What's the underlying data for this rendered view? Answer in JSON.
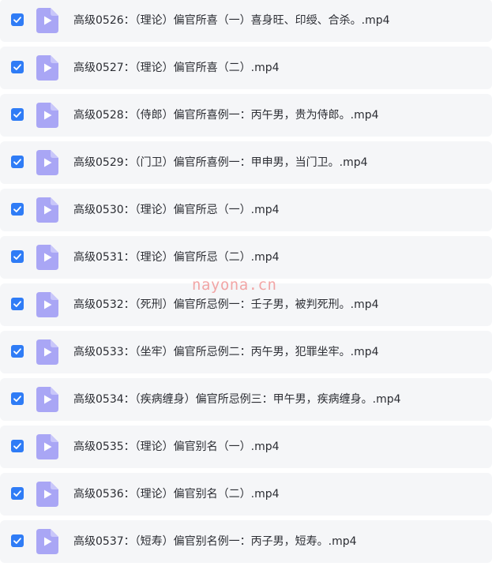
{
  "files": [
    {
      "name": "高级0526：（理论）偏官所喜（一）喜身旺、印绶、合杀。.mp4",
      "checked": true
    },
    {
      "name": "高级0527：（理论）偏官所喜（二）.mp4",
      "checked": true
    },
    {
      "name": "高级0528：（侍郎）偏官所喜例一：丙午男，贵为侍郎。.mp4",
      "checked": true
    },
    {
      "name": "高级0529：（门卫）偏官所喜例一：甲申男，当门卫。.mp4",
      "checked": true
    },
    {
      "name": "高级0530：（理论）偏官所忌（一）.mp4",
      "checked": true
    },
    {
      "name": "高级0531：（理论）偏官所忌（二）.mp4",
      "checked": true
    },
    {
      "name": "高级0532：（死刑）偏官所忌例一：壬子男，被判死刑。.mp4",
      "checked": true
    },
    {
      "name": "高级0533：（坐牢）偏官所忌例二：丙午男，犯罪坐牢。.mp4",
      "checked": true
    },
    {
      "name": "高级0534：（疾病缠身）偏官所忌例三：甲午男，疾病缠身。.mp4",
      "checked": true
    },
    {
      "name": "高级0535：（理论）偏官别名（一）.mp4",
      "checked": true
    },
    {
      "name": "高级0536：（理论）偏官别名（二）.mp4",
      "checked": true
    },
    {
      "name": "高级0537：（短寿）偏官别名例一：丙子男，短寿。.mp4",
      "checked": true
    }
  ],
  "watermark": "nayona.cn",
  "icons": {
    "checkbox": "checkmark-icon",
    "file": "video-file-icon"
  },
  "colors": {
    "row_background": "#f5f6f8",
    "checkbox": "#2f7cf6",
    "file_icon": "#a9a6f5",
    "text": "#2b2d33",
    "watermark": "#f08a8a"
  }
}
